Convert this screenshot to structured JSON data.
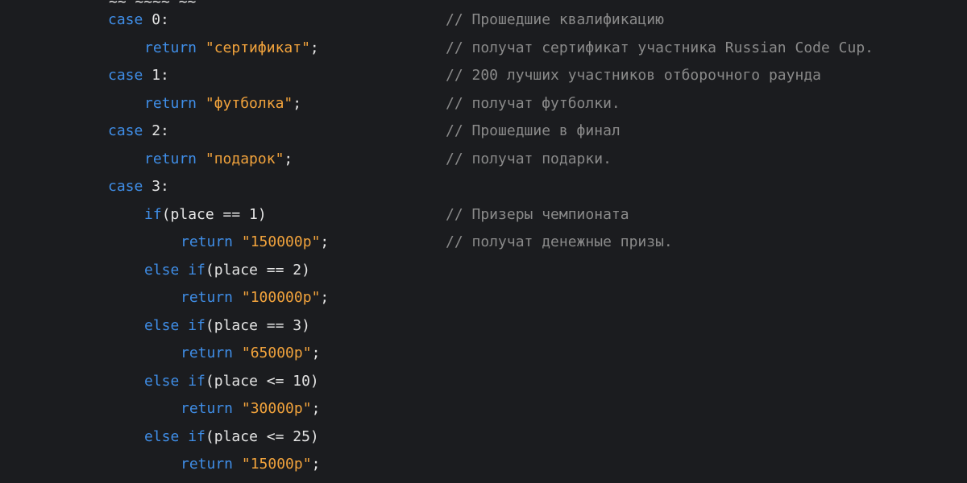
{
  "editor": {
    "colors": {
      "background": "#1b1c1f",
      "keyword": "#3f8de6",
      "string": "#f2a33c",
      "text": "#e6e6e6",
      "comment": "#8a8a8a"
    },
    "partial_top": "~~ ~~~~ ~~",
    "lines": [
      {
        "indent": 0,
        "tokens": [
          {
            "t": "case",
            "c": "kw"
          },
          {
            "t": " 0:",
            "c": "punct"
          }
        ],
        "comment": "// Прошедшие квалификацию"
      },
      {
        "indent": 1,
        "tokens": [
          {
            "t": "return",
            "c": "kw"
          },
          {
            "t": " ",
            "c": "punct"
          },
          {
            "t": "\"сертификат\"",
            "c": "str"
          },
          {
            "t": ";",
            "c": "punct"
          }
        ],
        "comment": "// получат сертификат участника Russian Code Cup."
      },
      {
        "indent": 0,
        "tokens": [
          {
            "t": "case",
            "c": "kw"
          },
          {
            "t": " 1:",
            "c": "punct"
          }
        ],
        "comment": "// 200 лучших участников отборочного раунда"
      },
      {
        "indent": 1,
        "tokens": [
          {
            "t": "return",
            "c": "kw"
          },
          {
            "t": " ",
            "c": "punct"
          },
          {
            "t": "\"футболка\"",
            "c": "str"
          },
          {
            "t": ";",
            "c": "punct"
          }
        ],
        "comment": "// получат футболки."
      },
      {
        "indent": 0,
        "tokens": [
          {
            "t": "case",
            "c": "kw"
          },
          {
            "t": " 2:",
            "c": "punct"
          }
        ],
        "comment": "// Прошедшие в финал"
      },
      {
        "indent": 1,
        "tokens": [
          {
            "t": "return",
            "c": "kw"
          },
          {
            "t": " ",
            "c": "punct"
          },
          {
            "t": "\"подарок\"",
            "c": "str"
          },
          {
            "t": ";",
            "c": "punct"
          }
        ],
        "comment": "// получат подарки."
      },
      {
        "indent": 0,
        "tokens": [
          {
            "t": "case",
            "c": "kw"
          },
          {
            "t": " 3:",
            "c": "punct"
          }
        ],
        "comment": ""
      },
      {
        "indent": 1,
        "tokens": [
          {
            "t": "if",
            "c": "kw"
          },
          {
            "t": "(place == 1)",
            "c": "punct"
          }
        ],
        "comment": "// Призеры чемпионата"
      },
      {
        "indent": 2,
        "tokens": [
          {
            "t": "return",
            "c": "kw"
          },
          {
            "t": " ",
            "c": "punct"
          },
          {
            "t": "\"150000р\"",
            "c": "str"
          },
          {
            "t": ";",
            "c": "punct"
          }
        ],
        "comment": "// получат денежные призы."
      },
      {
        "indent": 1,
        "tokens": [
          {
            "t": "else",
            "c": "kw"
          },
          {
            "t": " ",
            "c": "punct"
          },
          {
            "t": "if",
            "c": "kw"
          },
          {
            "t": "(place == 2)",
            "c": "punct"
          }
        ],
        "comment": ""
      },
      {
        "indent": 2,
        "tokens": [
          {
            "t": "return",
            "c": "kw"
          },
          {
            "t": " ",
            "c": "punct"
          },
          {
            "t": "\"100000р\"",
            "c": "str"
          },
          {
            "t": ";",
            "c": "punct"
          }
        ],
        "comment": ""
      },
      {
        "indent": 1,
        "tokens": [
          {
            "t": "else",
            "c": "kw"
          },
          {
            "t": " ",
            "c": "punct"
          },
          {
            "t": "if",
            "c": "kw"
          },
          {
            "t": "(place == 3)",
            "c": "punct"
          }
        ],
        "comment": ""
      },
      {
        "indent": 2,
        "tokens": [
          {
            "t": "return",
            "c": "kw"
          },
          {
            "t": " ",
            "c": "punct"
          },
          {
            "t": "\"65000р\"",
            "c": "str"
          },
          {
            "t": ";",
            "c": "punct"
          }
        ],
        "comment": ""
      },
      {
        "indent": 1,
        "tokens": [
          {
            "t": "else",
            "c": "kw"
          },
          {
            "t": " ",
            "c": "punct"
          },
          {
            "t": "if",
            "c": "kw"
          },
          {
            "t": "(place <= 10)",
            "c": "punct"
          }
        ],
        "comment": ""
      },
      {
        "indent": 2,
        "tokens": [
          {
            "t": "return",
            "c": "kw"
          },
          {
            "t": " ",
            "c": "punct"
          },
          {
            "t": "\"30000р\"",
            "c": "str"
          },
          {
            "t": ";",
            "c": "punct"
          }
        ],
        "comment": ""
      },
      {
        "indent": 1,
        "tokens": [
          {
            "t": "else",
            "c": "kw"
          },
          {
            "t": " ",
            "c": "punct"
          },
          {
            "t": "if",
            "c": "kw"
          },
          {
            "t": "(place <= 25)",
            "c": "punct"
          }
        ],
        "comment": ""
      },
      {
        "indent": 2,
        "tokens": [
          {
            "t": "return",
            "c": "kw"
          },
          {
            "t": " ",
            "c": "punct"
          },
          {
            "t": "\"15000р\"",
            "c": "str"
          },
          {
            "t": ";",
            "c": "punct"
          }
        ],
        "comment": ""
      }
    ]
  }
}
